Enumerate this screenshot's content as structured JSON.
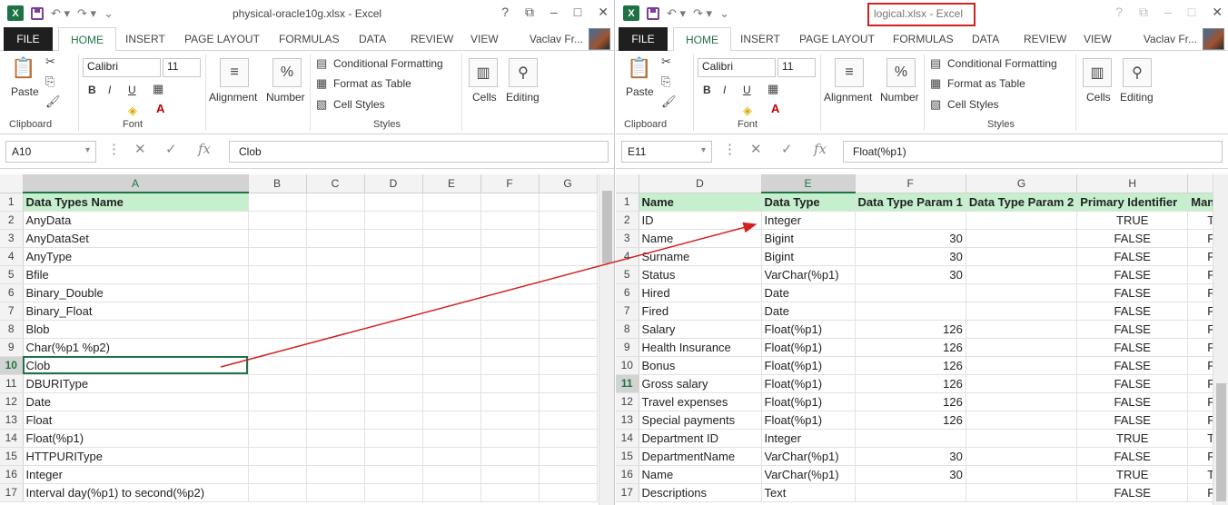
{
  "left": {
    "title": "physical-oracle10g.xlsx - Excel",
    "tabs": {
      "file": "FILE",
      "home": "HOME",
      "insert": "INSERT",
      "page_layout": "PAGE LAYOUT",
      "formulas": "FORMULAS",
      "data": "DATA",
      "review": "REVIEW",
      "view": "VIEW"
    },
    "user": "Vaclav Fr...",
    "ribbon": {
      "paste": "Paste",
      "clipboard": "Clipboard",
      "font_name": "Calibri",
      "font_size": "11",
      "font": "Font",
      "alignment": "Alignment",
      "number": "Number",
      "cond_fmt": "Conditional Formatting",
      "fmt_table": "Format as Table",
      "cell_styles": "Cell Styles",
      "styles": "Styles",
      "cells": "Cells",
      "editing": "Editing",
      "bold": "B",
      "italic": "I",
      "underline": "U",
      "percent": "%"
    },
    "namebox": "A10",
    "formula": "Clob",
    "columns": [
      "A",
      "B",
      "C",
      "D",
      "E",
      "F",
      "G"
    ],
    "rows": [
      {
        "n": "1",
        "a": "Data Types Name"
      },
      {
        "n": "2",
        "a": "AnyData"
      },
      {
        "n": "3",
        "a": "AnyDataSet"
      },
      {
        "n": "4",
        "a": "AnyType"
      },
      {
        "n": "5",
        "a": "Bfile"
      },
      {
        "n": "6",
        "a": "Binary_Double"
      },
      {
        "n": "7",
        "a": "Binary_Float"
      },
      {
        "n": "8",
        "a": "Blob"
      },
      {
        "n": "9",
        "a": "Char(%p1 %p2)"
      },
      {
        "n": "10",
        "a": "Clob"
      },
      {
        "n": "11",
        "a": "DBURIType"
      },
      {
        "n": "12",
        "a": "Date"
      },
      {
        "n": "13",
        "a": "Float"
      },
      {
        "n": "14",
        "a": "Float(%p1)"
      },
      {
        "n": "15",
        "a": "HTTPURIType"
      },
      {
        "n": "16",
        "a": "Integer"
      },
      {
        "n": "17",
        "a": "Interval day(%p1) to second(%p2)"
      }
    ]
  },
  "right": {
    "title": "logical.xlsx - Excel",
    "tabs": {
      "file": "FILE",
      "home": "HOME",
      "insert": "INSERT",
      "page_layout": "PAGE LAYOUT",
      "formulas": "FORMULAS",
      "data": "DATA",
      "review": "REVIEW",
      "view": "VIEW"
    },
    "user": "Vaclav Fr...",
    "ribbon": {
      "paste": "Paste",
      "clipboard": "Clipboard",
      "font_name": "Calibri",
      "font_size": "11",
      "font": "Font",
      "alignment": "Alignment",
      "number": "Number",
      "cond_fmt": "Conditional Formatting",
      "fmt_table": "Format as Table",
      "cell_styles": "Cell Styles",
      "styles": "Styles",
      "cells": "Cells",
      "editing": "Editing",
      "bold": "B",
      "italic": "I",
      "underline": "U",
      "percent": "%"
    },
    "namebox": "E11",
    "formula": "Float(%p1)",
    "columns": [
      "D",
      "E",
      "F",
      "G",
      "H",
      ""
    ],
    "header": [
      "Name",
      "Data Type",
      "Data Type Param 1",
      "Data Type Param 2",
      "Primary Identifier",
      "Man"
    ],
    "rows": [
      {
        "n": "2",
        "d": "ID",
        "e": "Integer",
        "f": "",
        "g": "",
        "h": "TRUE",
        "i": "T"
      },
      {
        "n": "3",
        "d": "Name",
        "e": "Bigint",
        "f": "30",
        "g": "",
        "h": "FALSE",
        "i": "F"
      },
      {
        "n": "4",
        "d": "Surname",
        "e": "Bigint",
        "f": "30",
        "g": "",
        "h": "FALSE",
        "i": "F"
      },
      {
        "n": "5",
        "d": "Status",
        "e": "VarChar(%p1)",
        "f": "30",
        "g": "",
        "h": "FALSE",
        "i": "F"
      },
      {
        "n": "6",
        "d": "Hired",
        "e": "Date",
        "f": "",
        "g": "",
        "h": "FALSE",
        "i": "F"
      },
      {
        "n": "7",
        "d": "Fired",
        "e": "Date",
        "f": "",
        "g": "",
        "h": "FALSE",
        "i": "F"
      },
      {
        "n": "8",
        "d": "Salary",
        "e": "Float(%p1)",
        "f": "126",
        "g": "",
        "h": "FALSE",
        "i": "F"
      },
      {
        "n": "9",
        "d": "Health Insurance",
        "e": "Float(%p1)",
        "f": "126",
        "g": "",
        "h": "FALSE",
        "i": "F"
      },
      {
        "n": "10",
        "d": "Bonus",
        "e": "Float(%p1)",
        "f": "126",
        "g": "",
        "h": "FALSE",
        "i": "F"
      },
      {
        "n": "11",
        "d": "Gross salary",
        "e": "Float(%p1)",
        "f": "126",
        "g": "",
        "h": "FALSE",
        "i": "F"
      },
      {
        "n": "12",
        "d": "Travel expenses",
        "e": "Float(%p1)",
        "f": "126",
        "g": "",
        "h": "FALSE",
        "i": "F"
      },
      {
        "n": "13",
        "d": "Special payments",
        "e": "Float(%p1)",
        "f": "126",
        "g": "",
        "h": "FALSE",
        "i": "F"
      },
      {
        "n": "14",
        "d": "Department ID",
        "e": "Integer",
        "f": "",
        "g": "",
        "h": "TRUE",
        "i": "T"
      },
      {
        "n": "15",
        "d": "DepartmentName",
        "e": "VarChar(%p1)",
        "f": "30",
        "g": "",
        "h": "FALSE",
        "i": "F"
      },
      {
        "n": "16",
        "d": "Name",
        "e": "VarChar(%p1)",
        "f": "30",
        "g": "",
        "h": "TRUE",
        "i": "T"
      },
      {
        "n": "17",
        "d": "Descriptions",
        "e": "Text",
        "f": "",
        "g": "",
        "h": "FALSE",
        "i": "F"
      }
    ]
  },
  "colors": {
    "excel_green": "#217346",
    "header_fill": "#c6efce",
    "arrow": "#d32020"
  }
}
